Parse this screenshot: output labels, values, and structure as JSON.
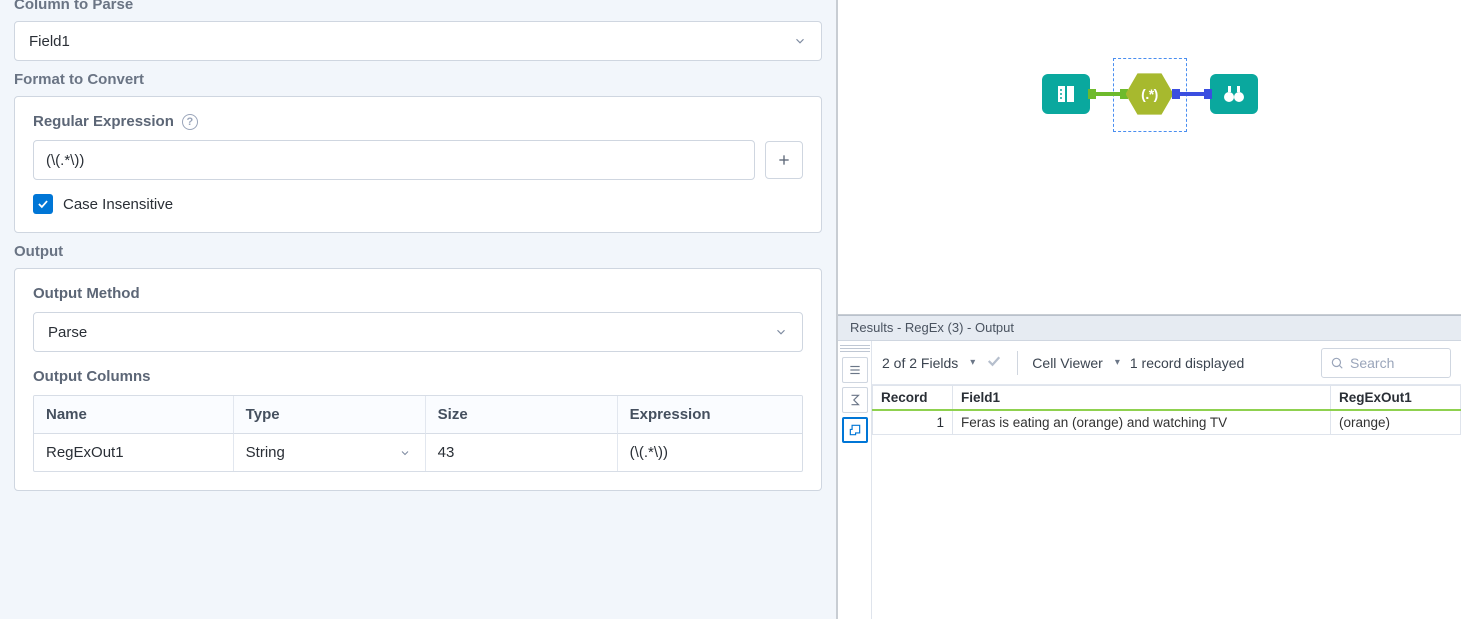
{
  "config": {
    "column_to_parse": {
      "label": "Column to Parse",
      "value": "Field1"
    },
    "format": {
      "label": "Format to Convert",
      "regex_label": "Regular Expression",
      "regex_value": "(\\(.*\\))",
      "case_insensitive_label": "Case Insensitive"
    },
    "output": {
      "label": "Output",
      "method_label": "Output Method",
      "method_value": "Parse",
      "columns_label": "Output Columns",
      "headers": {
        "name": "Name",
        "type": "Type",
        "size": "Size",
        "expr": "Expression"
      },
      "rows": [
        {
          "name": "RegExOut1",
          "type": "String",
          "size": "43",
          "expr": "(\\(.*\\))"
        }
      ]
    }
  },
  "canvas": {
    "regex_node_label": "(.*)"
  },
  "results": {
    "title": "Results - RegEx (3) - Output",
    "fields_summary": "2 of 2 Fields",
    "cell_viewer_label": "Cell Viewer",
    "record_count_text": "1 record displayed",
    "search_placeholder": "Search",
    "columns": {
      "record": "Record",
      "field1": "Field1",
      "out": "RegExOut1"
    },
    "rows": [
      {
        "record": "1",
        "field1": "Feras is eating an (orange) and watching TV",
        "out": "(orange)"
      }
    ]
  }
}
